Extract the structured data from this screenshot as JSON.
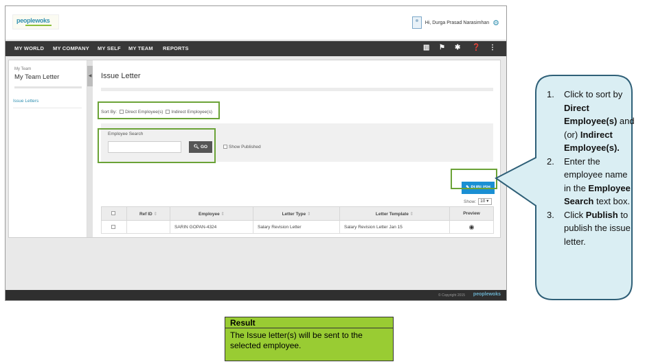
{
  "app": {
    "logo_text": "peoplewoks",
    "user_greeting": "Hi, Durga Prasad Narasimhan"
  },
  "nav": {
    "items": [
      "MY WORLD",
      "MY COMPANY",
      "MY SELF",
      "MY TEAM",
      "REPORTS"
    ],
    "icons": [
      "book-icon",
      "flag-icon",
      "tools-icon",
      "help-icon",
      "share-icon"
    ]
  },
  "sidebar": {
    "breadcrumb": "My Team",
    "title": "My Team Letter",
    "links": [
      "Issue Letters"
    ]
  },
  "main": {
    "page_title": "Issue Letter",
    "sort_by_label": "Sort By:",
    "sort_options": [
      "Direct Employee(s)",
      "Indirect Employee(s)"
    ],
    "search_label": "Employee Search",
    "search_value": "",
    "go_label": "GO",
    "show_published_label": "Show Published",
    "publish_label": "PUBLISH",
    "show_label": "Show:",
    "show_value": "10"
  },
  "table": {
    "columns": [
      "Ref ID",
      "Employee",
      "Letter Type",
      "Letter Template",
      "Preview"
    ],
    "rows": [
      {
        "ref_id": "",
        "employee": "SARIN GOPAN-4324",
        "letter_type": "Salary Revision Letter",
        "letter_template": "Salary Revision Letter Jan 15"
      }
    ]
  },
  "footer": {
    "copyright": "© Copyright 2015",
    "logo": "peoplewoks"
  },
  "callout": {
    "steps": [
      {
        "num": "1.",
        "parts": [
          {
            "t": "Click to sort by ",
            "b": false
          },
          {
            "t": "Direct Employee(s)",
            "b": true
          },
          {
            "t": " and (or) ",
            "b": false
          },
          {
            "t": "Indirect Employee(s).",
            "b": true
          }
        ]
      },
      {
        "num": "2.",
        "parts": [
          {
            "t": "Enter the employee name in the ",
            "b": false
          },
          {
            "t": "Employee Search",
            "b": true
          },
          {
            "t": " text box.",
            "b": false
          }
        ]
      },
      {
        "num": "3.",
        "parts": [
          {
            "t": "Click ",
            "b": false
          },
          {
            "t": "Publish",
            "b": true
          },
          {
            "t": " to publish the issue letter.",
            "b": false
          }
        ]
      }
    ]
  },
  "result": {
    "heading": "Result",
    "text": "The Issue letter(s) will be sent to the selected employee."
  },
  "colors": {
    "highlight": "#6aa236",
    "callout_fill": "#daeef3",
    "callout_border": "#2e5f77",
    "publish_button": "#1a8fd3",
    "result_fill": "#99cc33"
  }
}
